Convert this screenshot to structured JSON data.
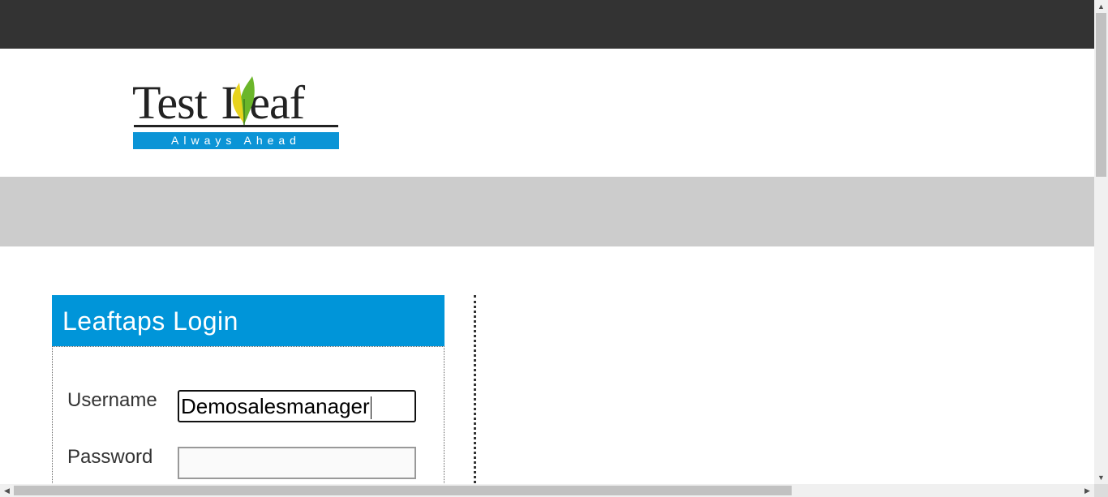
{
  "header": {
    "logo": {
      "name": "TestLeaf",
      "text_left": "Test",
      "text_right": "eaf",
      "tagline": "Always Ahead"
    }
  },
  "login": {
    "title": "Leaftaps Login",
    "username": {
      "label": "Username",
      "value": "Demosalesmanager"
    },
    "password": {
      "label": "Password",
      "value": ""
    }
  },
  "colors": {
    "topbar": "#333333",
    "navbar": "#cccccc",
    "login_header": "#0095d9",
    "logo_tagline_bg": "#0b94d6",
    "leaf_green": "#6bb62a",
    "leaf_yellow": "#e8d31c"
  },
  "scrollbars": {
    "vertical": {
      "up_icon": "triangle-up",
      "down_icon": "triangle-down"
    },
    "horizontal": {
      "left_icon": "triangle-left",
      "right_icon": "triangle-right"
    }
  }
}
